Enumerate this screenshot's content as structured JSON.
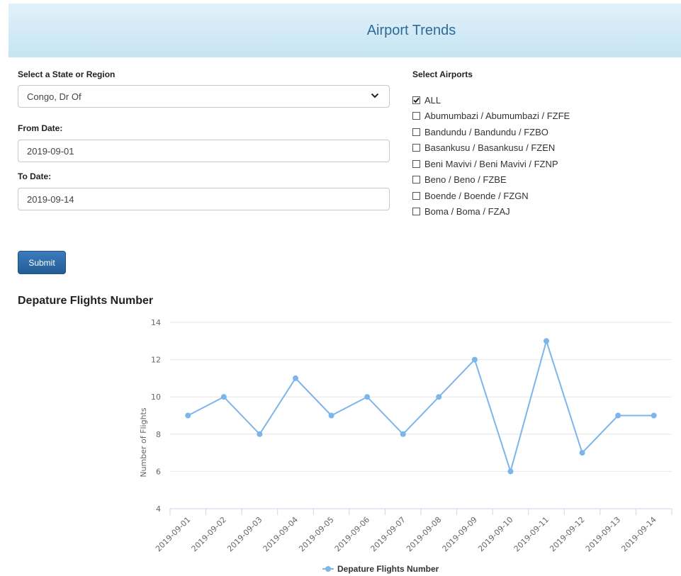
{
  "app": {
    "title": "Airport Trends"
  },
  "form": {
    "state_label": "Select a State or Region",
    "state_value": "Congo, Dr Of",
    "from_label": "From Date:",
    "from_value": "2019-09-01",
    "to_label": "To Date:",
    "to_value": "2019-09-14",
    "submit_label": "Submit"
  },
  "airports": {
    "label": "Select Airports",
    "items": [
      {
        "label": "ALL",
        "checked": true
      },
      {
        "label": "Abumumbazi / Abumumbazi / FZFE",
        "checked": false
      },
      {
        "label": "Bandundu / Bandundu / FZBO",
        "checked": false
      },
      {
        "label": "Basankusu / Basankusu / FZEN",
        "checked": false
      },
      {
        "label": "Beni Mavivi / Beni Mavivi / FZNP",
        "checked": false
      },
      {
        "label": "Beno / Beno / FZBE",
        "checked": false
      },
      {
        "label": "Boende / Boende / FZGN",
        "checked": false
      },
      {
        "label": "Boma / Boma / FZAJ",
        "checked": false
      }
    ]
  },
  "chart_data": {
    "type": "line",
    "title": "Depature Flights Number",
    "ylabel": "Number of Flights",
    "xlabel": "",
    "ylim": [
      4,
      14
    ],
    "yticks": [
      4,
      6,
      8,
      10,
      12,
      14
    ],
    "categories": [
      "2019-09-01",
      "2019-09-02",
      "2019-09-03",
      "2019-09-04",
      "2019-09-05",
      "2019-09-06",
      "2019-09-07",
      "2019-09-08",
      "2019-09-09",
      "2019-09-10",
      "2019-09-11",
      "2019-09-12",
      "2019-09-13",
      "2019-09-14"
    ],
    "series": [
      {
        "name": "Depature Flights Number",
        "values": [
          9,
          10,
          8,
          11,
          9,
          10,
          8,
          10,
          12,
          6,
          13,
          7,
          9,
          9
        ],
        "color": "#7cb5ec"
      }
    ],
    "grid": true,
    "legend": "bottom-center"
  }
}
